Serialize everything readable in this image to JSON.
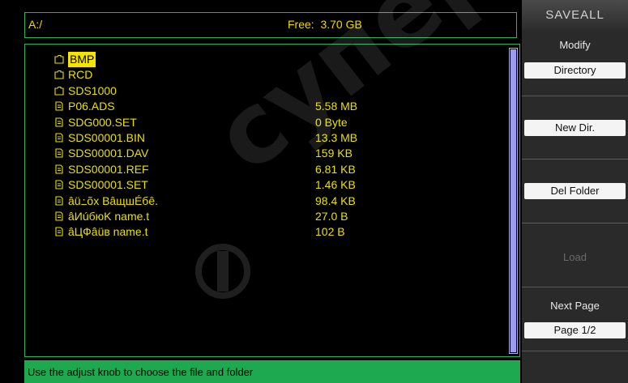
{
  "header": {
    "path": "A:/",
    "free_label": "Free:",
    "free_value": "3.70 GB"
  },
  "files": [
    {
      "type": "folder",
      "name": "BMP",
      "size": "",
      "selected": true
    },
    {
      "type": "folder",
      "name": "RCD",
      "size": ""
    },
    {
      "type": "folder",
      "name": "SDS1000",
      "size": ""
    },
    {
      "type": "file",
      "name": "P06.ADS",
      "size": "5.58 MB"
    },
    {
      "type": "file",
      "name": "SDG000.SET",
      "size": "0 Byte"
    },
    {
      "type": "file",
      "name": "SDS00001.BIN",
      "size": "13.3 MB"
    },
    {
      "type": "file",
      "name": "SDS00001.DAV",
      "size": "159 KB"
    },
    {
      "type": "file",
      "name": "SDS00001.REF",
      "size": "6.81 KB"
    },
    {
      "type": "file",
      "name": "SDS00001.SET",
      "size": "1.46 KB"
    },
    {
      "type": "file",
      "name": "âü߸õx BâщшÉбê.",
      "size": "98.4 KB"
    },
    {
      "type": "file",
      "name": "âИúбюK name.t",
      "size": "27.0 B"
    },
    {
      "type": "file",
      "name": "âЦФâüв name.t",
      "size": "102 B"
    }
  ],
  "status": {
    "message": "Use the adjust knob to choose the file and folder"
  },
  "menu": {
    "title": "SAVEALL",
    "modify_label": "Modify",
    "modify_value": "Directory",
    "new_dir": "New Dir.",
    "del_folder": "Del Folder",
    "load": "Load",
    "next_page_label": "Next Page",
    "next_page_value": "Page 1/2"
  },
  "watermark": {
    "text": "супер"
  },
  "colors": {
    "accent_green": "#2fb05a",
    "text_yellow": "#e8e000",
    "scrollbar": "#9b9bf0"
  }
}
